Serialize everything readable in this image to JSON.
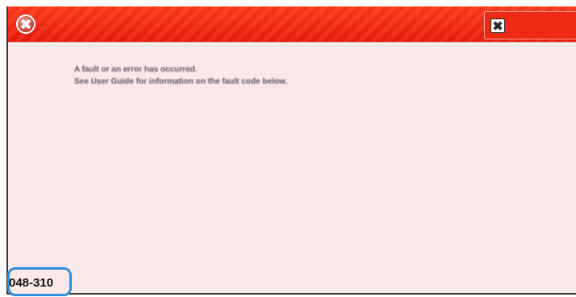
{
  "dialog": {
    "icons": {
      "title_icon": "error-x-circle-icon",
      "close_icon": "close-x-box-icon"
    },
    "colors": {
      "titlebar": "#ee2a14",
      "background": "#fbe9ea",
      "fault_code_highlight": "#2e8fd8"
    },
    "message_line_1": "A fault or an error has occurred.",
    "message_line_2": "See User Guide for information on the fault code below.",
    "fault_code": "048-310"
  }
}
